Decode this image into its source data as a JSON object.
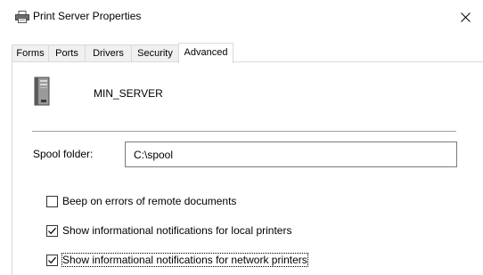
{
  "window": {
    "title": "Print Server Properties",
    "title_icon": "printer-icon",
    "close_icon": "close-icon"
  },
  "tabs": [
    {
      "label": "Forms",
      "active": false
    },
    {
      "label": "Ports",
      "active": false
    },
    {
      "label": "Drivers",
      "active": false
    },
    {
      "label": "Security",
      "active": false
    },
    {
      "label": "Advanced",
      "active": true
    }
  ],
  "server": {
    "icon": "server-icon",
    "name": "MIN_SERVER"
  },
  "spool": {
    "label": "Spool folder:",
    "value": "C:\\spool"
  },
  "options": [
    {
      "label": "Beep on errors of remote documents",
      "checked": false
    },
    {
      "label": "Show informational notifications for local printers",
      "checked": true
    },
    {
      "label": "Show informational notifications for network printers",
      "checked": true
    }
  ]
}
